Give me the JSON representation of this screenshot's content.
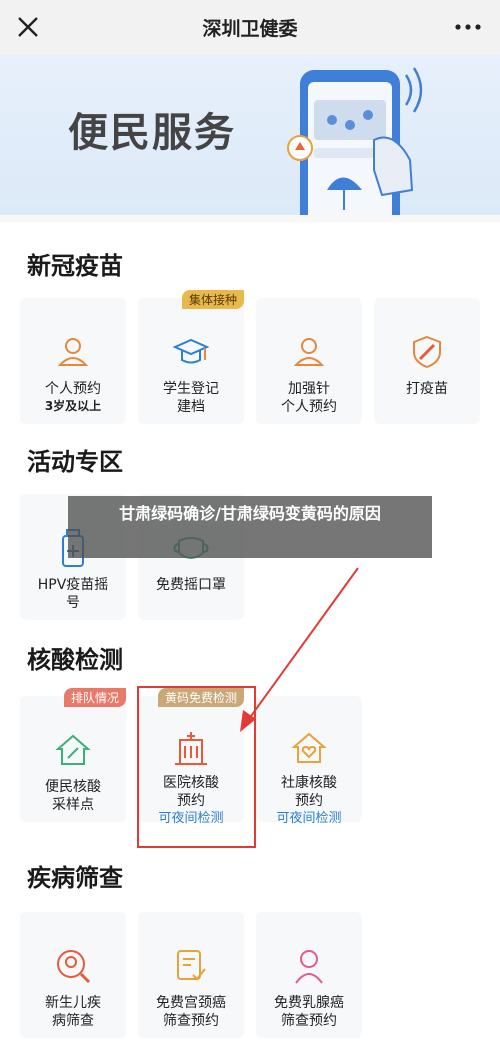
{
  "window": {
    "title": "深圳卫健委"
  },
  "banner": {
    "title": "便民服务"
  },
  "sections": {
    "vaccine": {
      "title": "新冠疫苗",
      "tiles": [
        {
          "label": "个人预约",
          "sub": "3岁及以上"
        },
        {
          "label": "学生登记\n建档",
          "badge": "集体接种"
        },
        {
          "label": "加强针\n个人预约"
        },
        {
          "label": "打疫苗"
        }
      ]
    },
    "activity": {
      "title": "活动专区",
      "tiles": [
        {
          "label": "HPV疫苗摇\n号"
        },
        {
          "label": "免费摇口罩"
        }
      ]
    },
    "nucleic": {
      "title": "核酸检测",
      "tiles": [
        {
          "label": "便民核酸\n采样点",
          "badge": "排队情况"
        },
        {
          "label": "医院核酸\n预约",
          "blue": "可夜间检测",
          "badge": "黄码免费检测"
        },
        {
          "label": "社康核酸\n预约",
          "blue": "可夜间检测"
        }
      ]
    },
    "screening": {
      "title": "疾病筛查",
      "tiles": [
        {
          "label": "新生儿疾\n病筛查"
        },
        {
          "label": "免费宫颈癌\n筛查预约"
        },
        {
          "label": "免费乳腺癌\n筛查预约"
        }
      ]
    }
  },
  "watermark": {
    "text": "甘肃绿码确诊/甘肃绿码变黄码的原因"
  },
  "colors": {
    "icon_orange": "#e8863a",
    "accent_blue": "#2b7fd6",
    "highlight_red": "#e53935",
    "badge_gold": "#e8b94b"
  }
}
